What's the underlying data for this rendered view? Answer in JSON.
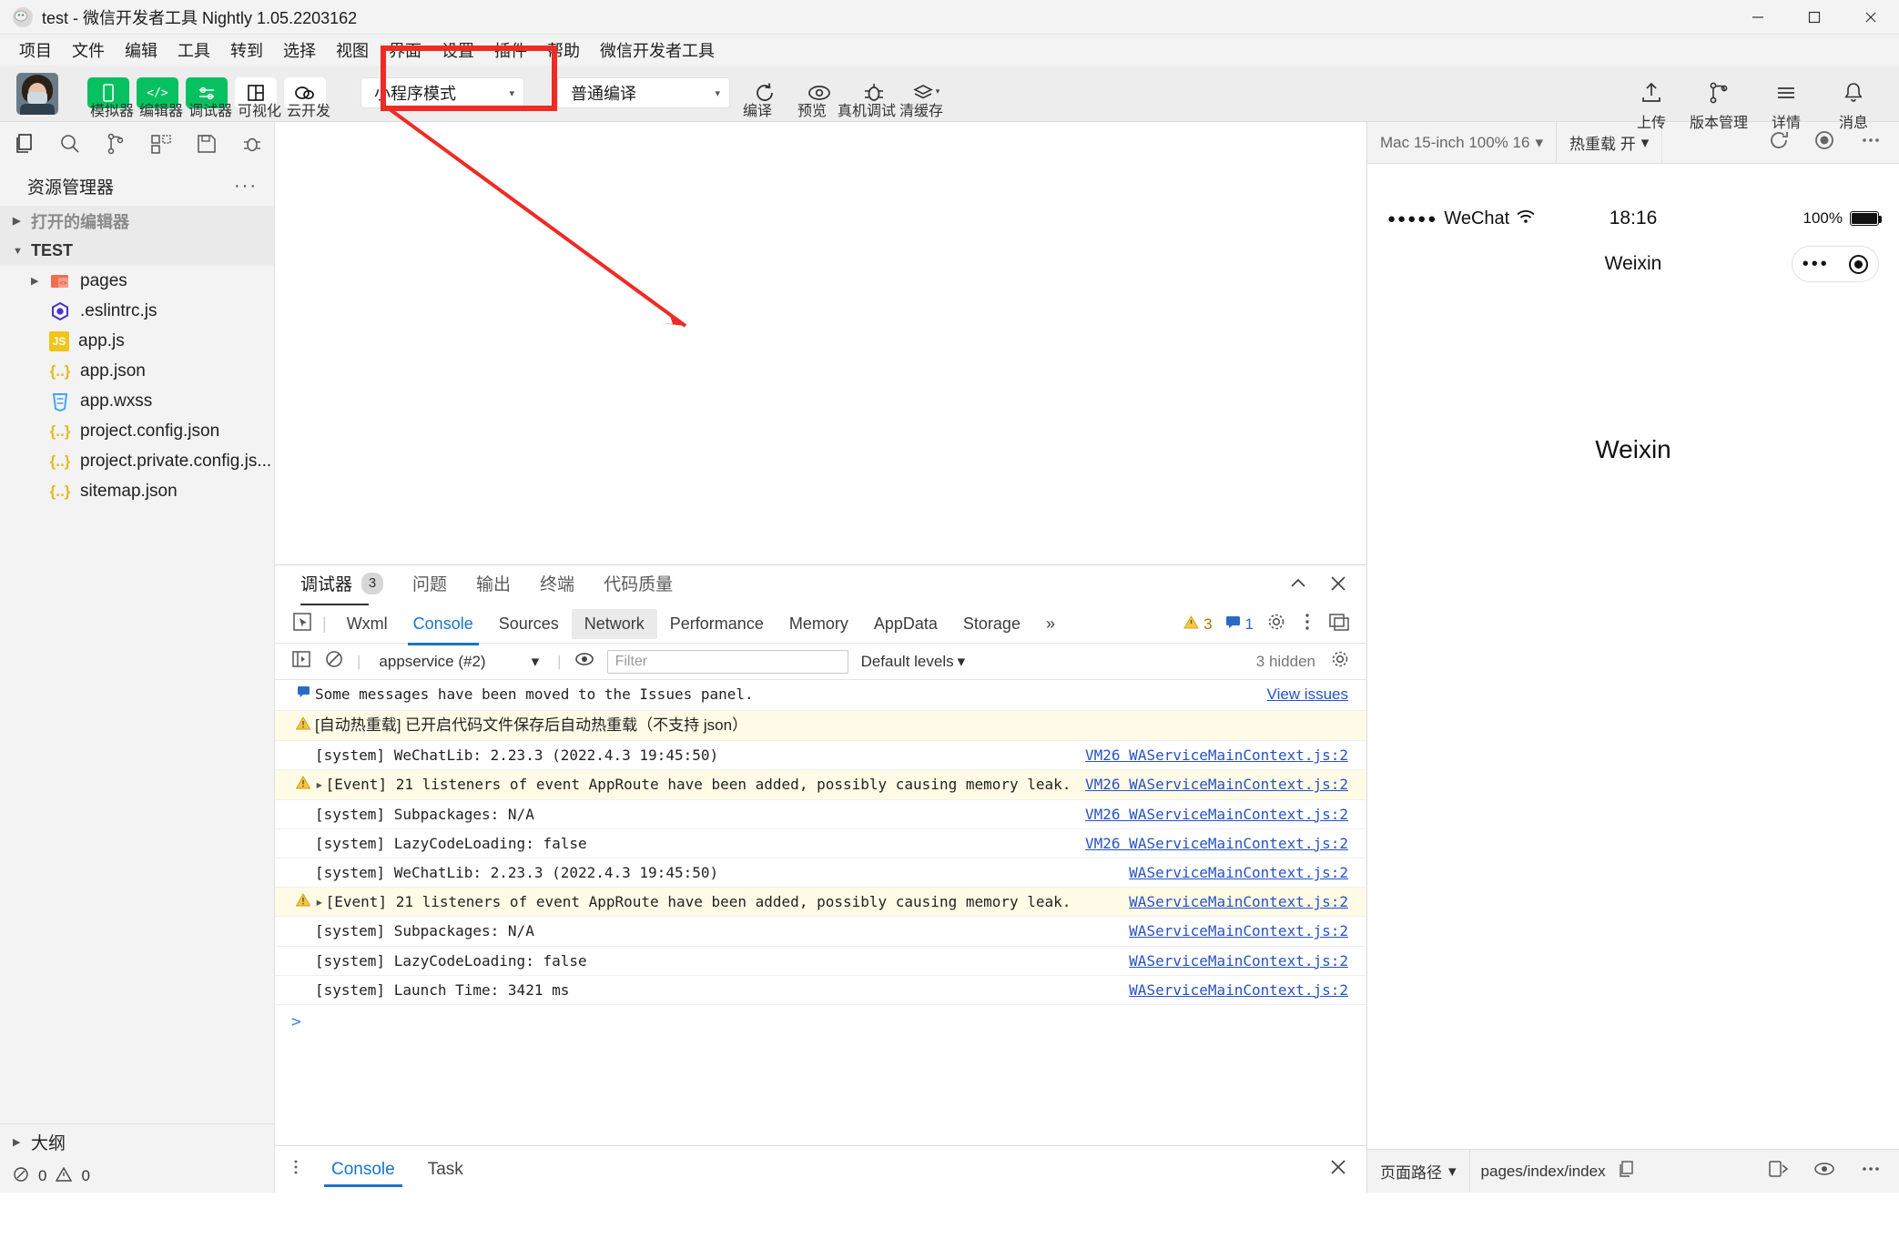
{
  "window": {
    "title": "test - 微信开发者工具 Nightly 1.05.2203162",
    "minimize": "—",
    "maximize": "▢",
    "close": "✕"
  },
  "menubar": {
    "items": [
      "项目",
      "文件",
      "编辑",
      "工具",
      "转到",
      "选择",
      "视图",
      "界面",
      "设置",
      "插件",
      "帮助",
      "微信开发者工具"
    ]
  },
  "toolbar": {
    "buttons": [
      {
        "label": "模拟器",
        "icon": "phone-icon",
        "style": "green"
      },
      {
        "label": "编辑器",
        "icon": "code-icon",
        "style": "green"
      },
      {
        "label": "调试器",
        "icon": "sliders-icon",
        "style": "green"
      },
      {
        "label": "可视化",
        "icon": "layout-icon",
        "style": "white"
      },
      {
        "label": "云开发",
        "icon": "cloud-icon",
        "style": "white"
      }
    ],
    "mode_select": {
      "value": "小程序模式",
      "caret": "▾"
    },
    "compile_select": {
      "value": "普通编译",
      "caret": "▾"
    },
    "actions": [
      {
        "label": "编译",
        "icon": "refresh-icon"
      },
      {
        "label": "预览",
        "icon": "eye-icon"
      },
      {
        "label": "真机调试",
        "icon": "bug-icon"
      },
      {
        "label": "清缓存",
        "icon": "layers-icon",
        "caret": "▾"
      }
    ],
    "right_actions": [
      {
        "label": "上传",
        "icon": "upload-icon"
      },
      {
        "label": "版本管理",
        "icon": "branch-icon"
      },
      {
        "label": "详情",
        "icon": "menu-icon"
      },
      {
        "label": "消息",
        "icon": "bell-icon"
      }
    ]
  },
  "activity_bar": {
    "icons": [
      "files-icon",
      "search-icon",
      "source-control-icon",
      "extensions-icon",
      "save-icon",
      "debug-icon"
    ]
  },
  "explorer": {
    "title": "资源管理器",
    "more": "···",
    "open_editors": {
      "label": "打开的编辑器",
      "arrow": "▶"
    },
    "project": {
      "label": "TEST",
      "arrow": "▼"
    },
    "files": [
      {
        "name": "pages",
        "type": "folder",
        "arrow": "▶",
        "icon": "folder-icon"
      },
      {
        "name": ".eslintrc.js",
        "type": "file",
        "icon": "eslint-icon"
      },
      {
        "name": "app.js",
        "type": "file",
        "icon": "js-icon"
      },
      {
        "name": "app.json",
        "type": "file",
        "icon": "json-icon"
      },
      {
        "name": "app.wxss",
        "type": "file",
        "icon": "css-icon"
      },
      {
        "name": "project.config.json",
        "type": "file",
        "icon": "json-icon"
      },
      {
        "name": "project.private.config.js...",
        "type": "file",
        "icon": "json-icon"
      },
      {
        "name": "sitemap.json",
        "type": "file",
        "icon": "json-icon"
      }
    ],
    "outline": {
      "label": "大纲",
      "arrow": "▶"
    },
    "status": {
      "errors": "0",
      "warnings": "0",
      "error_icon": "error-icon",
      "warning_icon": "warning-icon"
    }
  },
  "debugger": {
    "panel_tabs": [
      {
        "label": "调试器",
        "badge": "3",
        "active": true
      },
      {
        "label": "问题",
        "active": false
      },
      {
        "label": "输出",
        "active": false
      },
      {
        "label": "终端",
        "active": false
      },
      {
        "label": "代码质量",
        "active": false
      }
    ],
    "panel_actions": {
      "collapse": "chevron-up-icon",
      "close": "close-icon"
    },
    "devtools_tabs": [
      {
        "label": "Wxml",
        "state": "normal"
      },
      {
        "label": "Console",
        "state": "active"
      },
      {
        "label": "Sources",
        "state": "normal"
      },
      {
        "label": "Network",
        "state": "hover"
      },
      {
        "label": "Performance",
        "state": "normal"
      },
      {
        "label": "Memory",
        "state": "normal"
      },
      {
        "label": "AppData",
        "state": "normal"
      },
      {
        "label": "Storage",
        "state": "normal"
      },
      {
        "label": "»",
        "state": "more"
      }
    ],
    "counters": {
      "warnings": "3",
      "messages": "1"
    },
    "filter_bar": {
      "context": "appservice (#2)",
      "context_caret": "▾",
      "filter_placeholder": "Filter",
      "levels": "Default levels",
      "levels_caret": "▾",
      "hidden": "3 hidden"
    },
    "logs": [
      {
        "level": "info",
        "icon": "message-icon",
        "text": "Some messages have been moved to the Issues panel.",
        "link": "View issues",
        "link_type": "issues"
      },
      {
        "level": "warn",
        "icon": "warning-icon",
        "lang": "cn",
        "text": "[自动热重载] 已开启代码文件保存后自动热重载（不支持 json）",
        "link": ""
      },
      {
        "level": "log",
        "icon": "",
        "text": "[system] WeChatLib: 2.23.3 (2022.4.3 19:45:50)",
        "link": "VM26 WAServiceMainContext.js:2"
      },
      {
        "level": "warn",
        "icon": "warning-icon",
        "expand": "▸",
        "text": "[Event] 21 listeners of event AppRoute have been added, possibly causing memory leak.",
        "link": "VM26 WAServiceMainContext.js:2"
      },
      {
        "level": "log",
        "icon": "",
        "text": "[system] Subpackages: N/A",
        "link": "VM26 WAServiceMainContext.js:2"
      },
      {
        "level": "log",
        "icon": "",
        "text": "[system] LazyCodeLoading: false",
        "link": "VM26 WAServiceMainContext.js:2"
      },
      {
        "level": "log",
        "icon": "",
        "text": "[system] WeChatLib: 2.23.3 (2022.4.3 19:45:50)",
        "link": "WAServiceMainContext.js:2"
      },
      {
        "level": "warn",
        "icon": "warning-icon",
        "expand": "▸",
        "text": "[Event] 21 listeners of event AppRoute have been added, possibly causing memory leak.",
        "link": "WAServiceMainContext.js:2"
      },
      {
        "level": "log",
        "icon": "",
        "text": "[system] Subpackages: N/A",
        "link": "WAServiceMainContext.js:2"
      },
      {
        "level": "log",
        "icon": "",
        "text": "[system] LazyCodeLoading: false",
        "link": "WAServiceMainContext.js:2"
      },
      {
        "level": "log",
        "icon": "",
        "text": "[system] Launch Time: 3421 ms",
        "link": "WAServiceMainContext.js:2"
      }
    ],
    "prompt": ">",
    "bottom_tabs": [
      {
        "label": "Console",
        "active": true
      },
      {
        "label": "Task",
        "active": false
      }
    ],
    "bottom_close": "✕"
  },
  "simulator": {
    "device_select": {
      "value": "Mac 15-inch 100% 16",
      "caret": "▾"
    },
    "hotreload_select": {
      "value": "热重载 开",
      "caret": "▾"
    },
    "top_actions": [
      "refresh-icon",
      "record-icon",
      "more-icon"
    ],
    "status_bar": {
      "carrier_dots": "●●●●●",
      "carrier": "WeChat",
      "wifi": "wifi-icon",
      "time": "18:16",
      "battery": "100%"
    },
    "nav_title": "Weixin",
    "capsule": {
      "menu_dots": "•••",
      "target": "target-icon"
    },
    "page_text": "Weixin",
    "bottom": {
      "path_select": "页面路径",
      "path_caret": "▾",
      "path_value": "pages/index/index",
      "copy_icon": "copy-icon",
      "right_icons": [
        "device-icon",
        "eye-icon",
        "more-icon"
      ]
    }
  },
  "annotation": {
    "color": "#ee2b24",
    "shape": "box-with-arrow"
  }
}
